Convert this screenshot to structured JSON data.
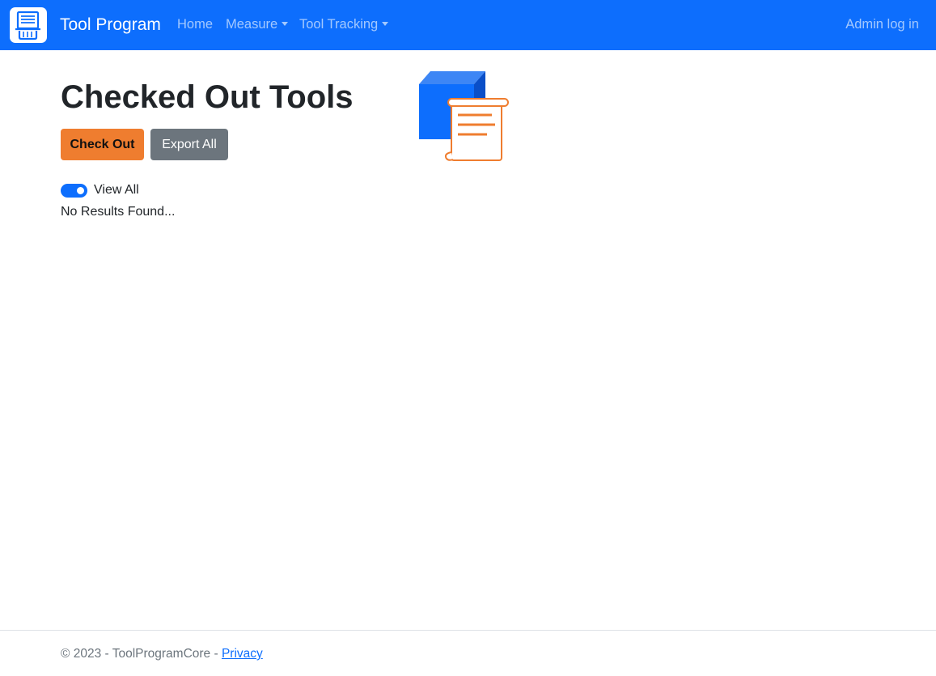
{
  "navbar": {
    "brand": "Tool Program",
    "links": [
      {
        "label": "Home"
      },
      {
        "label": "Measure"
      },
      {
        "label": "Tool Tracking"
      }
    ],
    "login": "Admin log in"
  },
  "main": {
    "title": "Checked Out Tools",
    "checkout_label": "Check Out",
    "export_label": "Export All",
    "toggle": {
      "label": "View All",
      "checked": true
    },
    "empty_message": "No Results Found..."
  },
  "footer": {
    "text": "© 2023 - ToolProgramCore - ",
    "privacy_label": "Privacy"
  },
  "colors": {
    "primary": "#0d6efd",
    "accent": "#ef7d2f",
    "secondary": "#6c757d"
  },
  "icons": {
    "brand": "tool-program-logo-icon",
    "hero": "box-scroll-illustration"
  }
}
